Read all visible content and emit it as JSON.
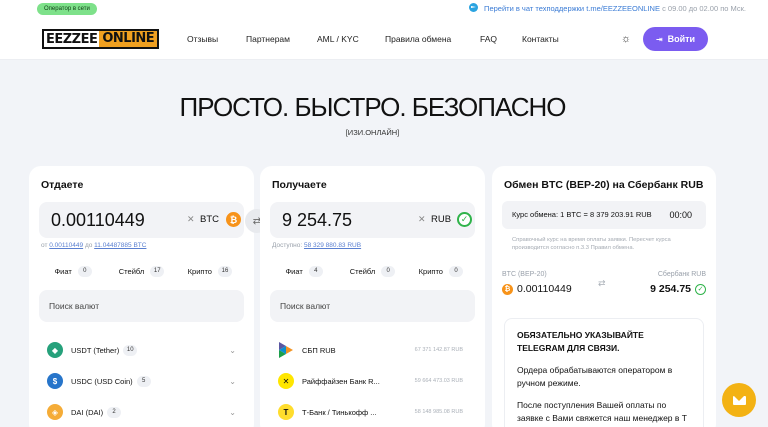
{
  "topbar": {
    "status": "Оператор в сети",
    "support_text": "Перейти в чат техподдержки t.me/EEZZEEONLINE",
    "hours": "с 09.00 до 02.00 по Мск."
  },
  "nav": {
    "logo_a": "EEZZEE",
    "logo_b": "ONLINE",
    "items": [
      "Отзывы",
      "Партнерам",
      "AML / KYC",
      "Правила обмена",
      "FAQ",
      "Контакты"
    ],
    "login": "Войти"
  },
  "hero": {
    "title": "ПРОСТО. БЫСТРО. БЕЗОПАСНО",
    "subtitle": "[ИЗИ.ОНЛАЙН]"
  },
  "give": {
    "title": "Отдаете",
    "amount": "0.00110449",
    "currency": "BTC",
    "range_prefix": "от",
    "range_min": "0.00110449",
    "range_mid": "до",
    "range_max": "11.04487885 BTC",
    "tabs": [
      {
        "label": "Фиат",
        "count": "0"
      },
      {
        "label": "Стейбл",
        "count": "17"
      },
      {
        "label": "Крипто",
        "count": "16"
      }
    ],
    "search_placeholder": "Поиск валют",
    "list": [
      {
        "name": "USDT (Tether)",
        "count": "10",
        "color": "#26a17b",
        "icon": "tether-icon"
      },
      {
        "name": "USDC (USD Coin)",
        "count": "5",
        "color": "#2775ca",
        "icon": "usdc-icon"
      },
      {
        "name": "DAI (DAI)",
        "count": "2",
        "color": "#f5ac37",
        "icon": "dai-icon"
      }
    ]
  },
  "get": {
    "title": "Получаете",
    "amount": "9 254.75",
    "currency": "RUB",
    "available_label": "Доступно:",
    "available": "58 329 880.83 RUB",
    "tabs": [
      {
        "label": "Фиат",
        "count": "4"
      },
      {
        "label": "Стейбл",
        "count": "0"
      },
      {
        "label": "Крипто",
        "count": "0"
      }
    ],
    "search_placeholder": "Поиск валют",
    "list": [
      {
        "name": "СБП RUB",
        "amount": "67 371 142.87 RUB",
        "icon": "sbp-icon"
      },
      {
        "name": "Райффайзен Банк R...",
        "amount": "59 664 473.03 RUB",
        "icon": "raiffeisen-icon"
      },
      {
        "name": "Т-Банк / Тинькофф ...",
        "amount": "58 148 985.08 RUB",
        "icon": "tbank-icon"
      }
    ]
  },
  "exchange": {
    "title": "Обмен BTC (BEP-20) на Сбербанк RUB",
    "rate": "Курс обмена: 1 BTC = 8 379 203.91 RUB",
    "timer": "00:00",
    "disclaimer": "Справочный курс на время оплаты заявки. Пересчет курса производится согласно п.3.3 Правил обмена.",
    "from_label": "BTC (BEP-20)",
    "from_value": "0.00110449",
    "to_label": "Сбербанк RUB",
    "to_value": "9 254.75",
    "notice_title": "ОБЯЗАТЕЛЬНО УКАЗЫВАЙТЕ TELEGRAM ДЛЯ СВЯЗИ.",
    "notice_p1": "Ордера обрабатываются оператором в ручном режиме.",
    "notice_p2": "После поступления Вашей оплаты по заявке с Вами свяжется наш менеджер в Т"
  },
  "colors": {
    "accent": "#7b5cf0",
    "online": "#7ee18a",
    "fab": "#f3b214",
    "btc": "#f7931a"
  }
}
